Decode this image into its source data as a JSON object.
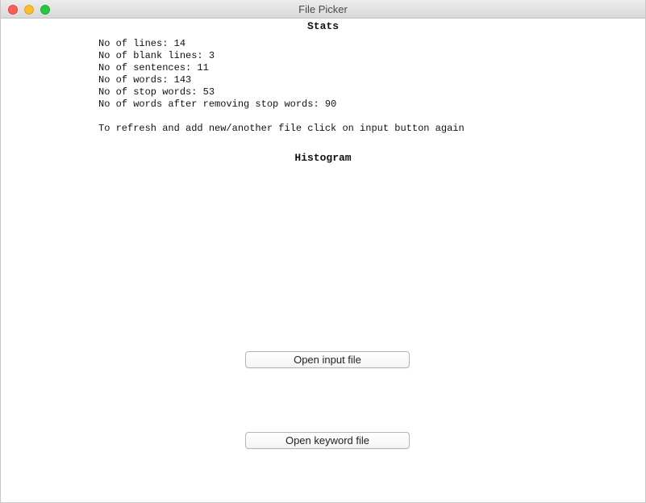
{
  "window": {
    "title": "File Picker"
  },
  "stats": {
    "heading": "Stats",
    "lines": [
      "No of lines: 14",
      "No of blank lines: 3",
      "No of sentences: 11",
      "No of words: 143",
      "No of stop words: 53",
      "No of words after removing stop words: 90"
    ],
    "refresh_note": "To refresh and add new/another file click on input button again"
  },
  "histogram": {
    "heading": "Histogram"
  },
  "buttons": {
    "open_input_label": "Open input file",
    "open_keyword_label": "Open keyword file"
  },
  "colors": {
    "close": "#fe5f57",
    "minimize": "#febc2e",
    "zoom": "#28c840"
  }
}
